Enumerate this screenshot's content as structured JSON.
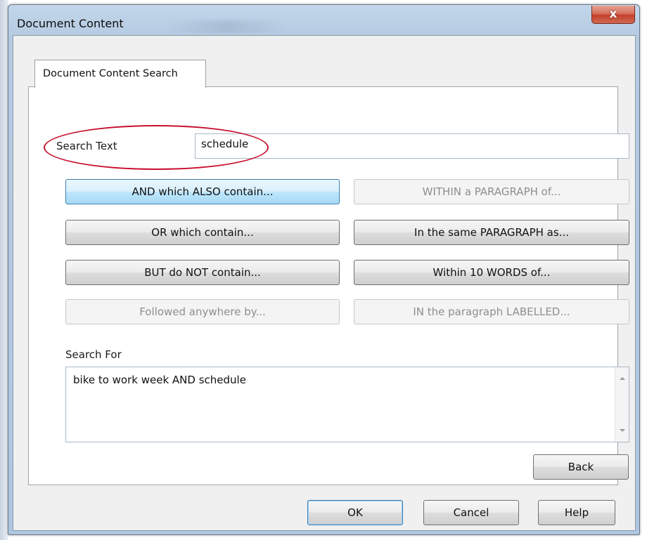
{
  "window": {
    "title": "Document Content",
    "close_label": "x"
  },
  "tabs": [
    {
      "label": "Document Content Search"
    }
  ],
  "search_text": {
    "label": "Search Text",
    "value": "schedule"
  },
  "operators": {
    "and_also": "AND which ALSO contain...",
    "within_paragraph": "WITHIN a PARAGRAPH of...",
    "or_contain": "OR which contain...",
    "same_paragraph": "In the same PARAGRAPH as...",
    "but_not": "BUT do NOT contain...",
    "within_words": "Within 10 WORDS of...",
    "followed_by": "Followed anywhere by...",
    "in_labelled": "IN the paragraph LABELLED..."
  },
  "search_for": {
    "label": "Search For",
    "value": "bike to work week AND schedule"
  },
  "buttons": {
    "back": "Back",
    "ok": "OK",
    "cancel": "Cancel",
    "help": "Help"
  },
  "colors": {
    "annotation_oval": "#c8102e",
    "focus_button": "#bee6fd",
    "disabled_text": "#8e8e8e"
  }
}
